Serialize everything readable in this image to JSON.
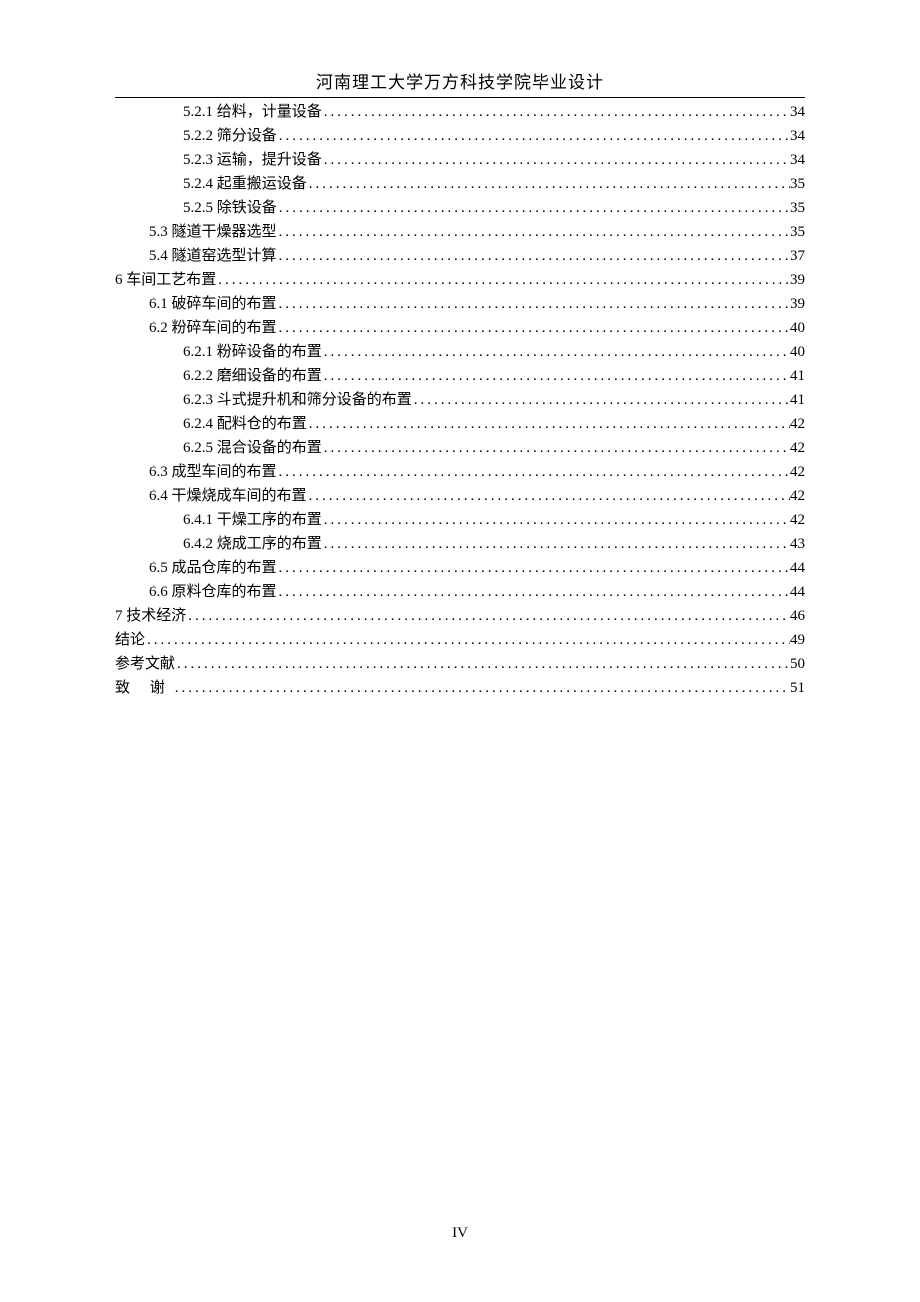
{
  "header": {
    "title": "河南理工大学万方科技学院毕业设计"
  },
  "toc": [
    {
      "level": 2,
      "label": "5.2.1 给料，计量设备",
      "page": "34"
    },
    {
      "level": 2,
      "label": "5.2.2 筛分设备",
      "page": "34"
    },
    {
      "level": 2,
      "label": "5.2.3 运输，提升设备",
      "page": "34"
    },
    {
      "level": 2,
      "label": "5.2.4 起重搬运设备",
      "page": "35"
    },
    {
      "level": 2,
      "label": "5.2.5 除铁设备",
      "page": "35"
    },
    {
      "level": 1,
      "label": "5.3 隧道干燥器选型",
      "page": "35"
    },
    {
      "level": 1,
      "label": "5.4 隧道窑选型计算",
      "page": "37"
    },
    {
      "level": 0,
      "label": "6 车间工艺布置",
      "page": "39"
    },
    {
      "level": 1,
      "label": "6.1 破碎车间的布置",
      "page": "39"
    },
    {
      "level": 1,
      "label": "6.2 粉碎车间的布置",
      "page": "40"
    },
    {
      "level": 2,
      "label": "6.2.1 粉碎设备的布置",
      "page": "40"
    },
    {
      "level": 2,
      "label": "6.2.2 磨细设备的布置",
      "page": "41"
    },
    {
      "level": 2,
      "label": "6.2.3 斗式提升机和筛分设备的布置",
      "page": "41"
    },
    {
      "level": 2,
      "label": "6.2.4 配料仓的布置",
      "page": "42"
    },
    {
      "level": 2,
      "label": "6.2.5 混合设备的布置",
      "page": "42"
    },
    {
      "level": 1,
      "label": "6.3 成型车间的布置",
      "page": "42"
    },
    {
      "level": 1,
      "label": "6.4 干燥烧成车间的布置",
      "page": "42"
    },
    {
      "level": 2,
      "label": "6.4.1 干燥工序的布置",
      "page": "42"
    },
    {
      "level": 2,
      "label": "6.4.2 烧成工序的布置",
      "page": "43"
    },
    {
      "level": 1,
      "label": "6.5 成品仓库的布置",
      "page": "44"
    },
    {
      "level": 1,
      "label": "6.6 原料仓库的布置",
      "page": "44"
    },
    {
      "level": 0,
      "label": "7 技术经济",
      "page": "46"
    },
    {
      "level": 0,
      "label": "结论",
      "page": "49"
    },
    {
      "level": 0,
      "label": "参考文献",
      "page": "50"
    },
    {
      "level": 0,
      "label": "致  谢",
      "page": "51",
      "spaced": true
    }
  ],
  "footer": {
    "pageNumber": "IV"
  }
}
